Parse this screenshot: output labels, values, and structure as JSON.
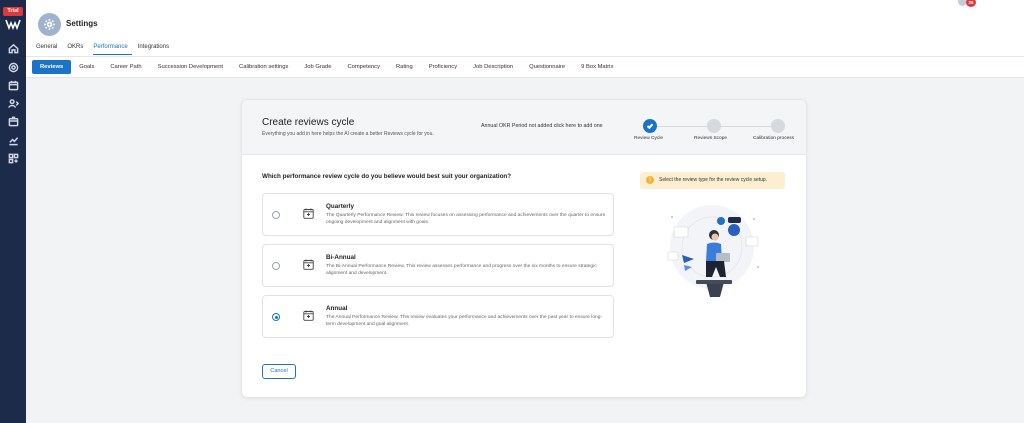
{
  "sidebar": {
    "trial_badge": "Trial",
    "icons": [
      "home-icon",
      "target-icon",
      "calendar-icon",
      "user-settings-icon",
      "box-icon",
      "chart-icon",
      "apps-icon"
    ]
  },
  "header": {
    "title": "Settings",
    "notification_count": "26",
    "tabs": [
      {
        "label": "General"
      },
      {
        "label": "OKRs"
      },
      {
        "label": "Performance"
      },
      {
        "label": "Integrations"
      }
    ]
  },
  "subtabs": [
    {
      "label": "Reviews"
    },
    {
      "label": "Goals"
    },
    {
      "label": "Career Path"
    },
    {
      "label": "Succession Development"
    },
    {
      "label": "Calibration settings"
    },
    {
      "label": "Job Grade"
    },
    {
      "label": "Competency"
    },
    {
      "label": "Rating"
    },
    {
      "label": "Proficiency"
    },
    {
      "label": "Job Description"
    },
    {
      "label": "Questionnaire"
    },
    {
      "label": "9 Box Matrix"
    }
  ],
  "card": {
    "title": "Create reviews cycle",
    "subtitle": "Everything you add in here helps the AI create a better Reviews cycle for you.",
    "okr_note": "Annual OKR Period not added click here to add one",
    "steps": [
      {
        "label": "Review Cycle",
        "status": "done"
      },
      {
        "label": "Reviews Scope",
        "status": "pending"
      },
      {
        "label": "Calibration process",
        "status": "pending"
      }
    ],
    "question": "Which performance review cycle do you believe would best suit your organization?",
    "options": [
      {
        "title": "Quarterly",
        "description": "The Quarterly Performance Review. This review focuses on assessing performance and achievements over the quarter to ensure ongoing development and alignment with goals.",
        "selected": false
      },
      {
        "title": "Bi-Annual",
        "description": "The Bi-Annual Performance Review. This review assesses performance and progress over the six months to ensure strategic alignment and development.",
        "selected": false
      },
      {
        "title": "Annual",
        "description": "The Annual Performance Review. This review evaluates your performance and achievements over the past year to ensure long-term development and goal alignment.",
        "selected": true
      }
    ],
    "cancel_label": "Cancel",
    "hint": "Select the review type for the review cycle setup."
  },
  "colors": {
    "accent": "#1a73c9",
    "sidebar": "#1c2b4a",
    "hint_bg": "#fcefd0",
    "badge": "#e0373a"
  }
}
